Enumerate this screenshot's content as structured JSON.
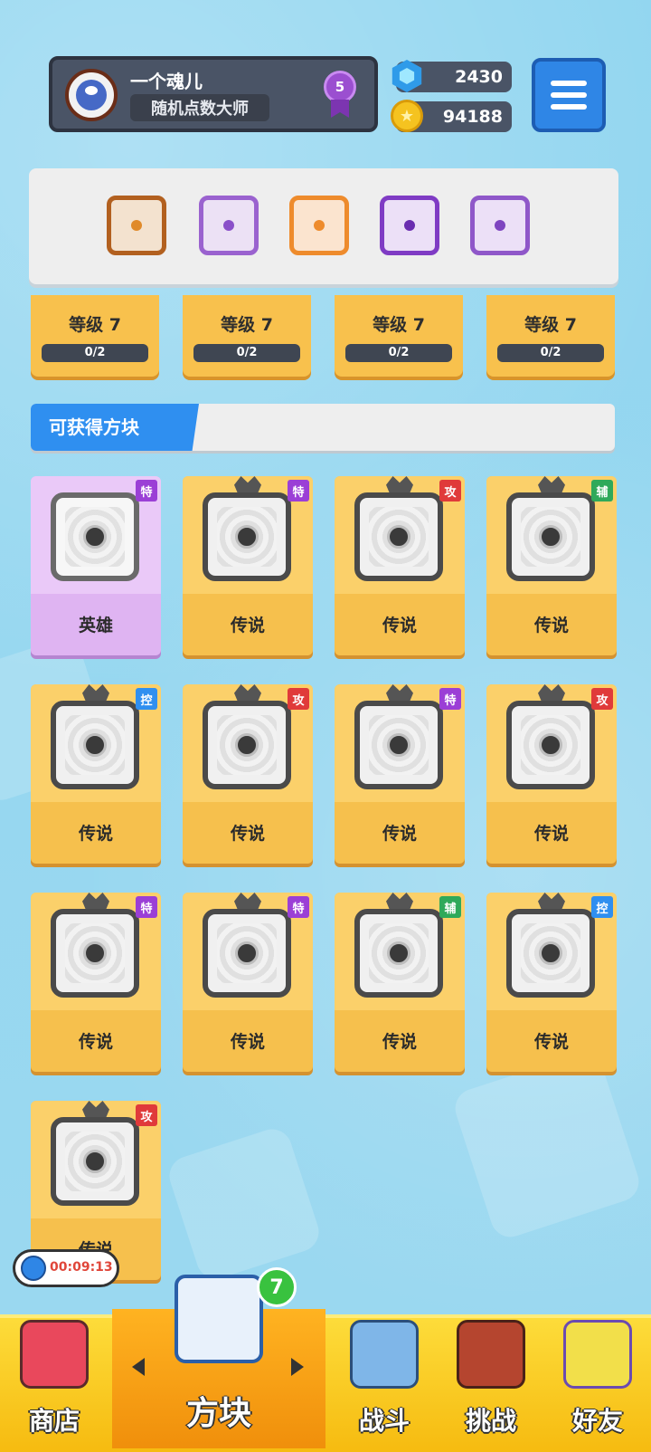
{
  "header": {
    "player_name": "一个魂儿",
    "player_title": "随机点数大师",
    "rank_level": "5",
    "gems": "2430",
    "coins": "94188"
  },
  "level_row": [
    {
      "level": "等级 7",
      "progress": "0/2"
    },
    {
      "level": "等级 7",
      "progress": "0/2"
    },
    {
      "level": "等级 7",
      "progress": "0/2"
    },
    {
      "level": "等级 7",
      "progress": "0/2"
    }
  ],
  "section": {
    "title": "可获得方块"
  },
  "cards": [
    {
      "rarity": "英雄",
      "tag": "特",
      "tag_color": "#9b3fd6"
    },
    {
      "rarity": "传说",
      "tag": "特",
      "tag_color": "#9b3fd6"
    },
    {
      "rarity": "传说",
      "tag": "攻",
      "tag_color": "#e03a3a"
    },
    {
      "rarity": "传说",
      "tag": "辅",
      "tag_color": "#2fa95a"
    },
    {
      "rarity": "传说",
      "tag": "控",
      "tag_color": "#2f8ff0"
    },
    {
      "rarity": "传说",
      "tag": "攻",
      "tag_color": "#e03a3a"
    },
    {
      "rarity": "传说",
      "tag": "特",
      "tag_color": "#9b3fd6"
    },
    {
      "rarity": "传说",
      "tag": "攻",
      "tag_color": "#e03a3a"
    },
    {
      "rarity": "传说",
      "tag": "特",
      "tag_color": "#9b3fd6"
    },
    {
      "rarity": "传说",
      "tag": "特",
      "tag_color": "#9b3fd6"
    },
    {
      "rarity": "传说",
      "tag": "辅",
      "tag_color": "#2fa95a"
    },
    {
      "rarity": "传说",
      "tag": "控",
      "tag_color": "#2f8ff0"
    },
    {
      "rarity": "传说",
      "tag": "攻",
      "tag_color": "#e03a3a"
    }
  ],
  "timer": "00:09:13",
  "nav": {
    "shop": "商店",
    "blocks": "方块",
    "blocks_badge": "7",
    "battle": "战斗",
    "challenge": "挑战",
    "friends": "好友"
  },
  "colors": {
    "accent_blue": "#2f8ff0",
    "card_gold": "#f6c04d",
    "card_hero": "#dfb4f2"
  }
}
